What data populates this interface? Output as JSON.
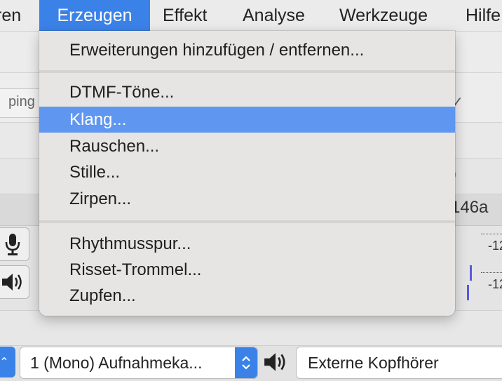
{
  "menubar": {
    "items": [
      {
        "label": "ren"
      },
      {
        "label": "Erzeugen"
      },
      {
        "label": "Effekt"
      },
      {
        "label": "Analyse"
      },
      {
        "label": "Werkzeuge"
      },
      {
        "label": "Hilfe"
      }
    ]
  },
  "menu": {
    "items": [
      {
        "label": "Erweiterungen hinzufügen / entfernen..."
      },
      {
        "label": "DTMF-Töne..."
      },
      {
        "label": "Klang..."
      },
      {
        "label": "Rauschen..."
      },
      {
        "label": "Stille..."
      },
      {
        "label": "Zirpen..."
      },
      {
        "label": "Rhythmusspur..."
      },
      {
        "label": "Risset-Trommel..."
      },
      {
        "label": "Zupfen..."
      }
    ],
    "selected": "Klang..."
  },
  "background": {
    "ping_text": "ping",
    "device_label_partial": "146a",
    "meter_label_1": "-12",
    "meter_label_2": "-12"
  },
  "device_bar": {
    "input_channels": "1 (Mono) Aufnahmeka...",
    "output_device": "Externe Kopfhörer"
  },
  "colors": {
    "accent": "#3b82e8",
    "menu_highlight": "#5f96ef",
    "menu_bg": "#e7e5e3"
  }
}
